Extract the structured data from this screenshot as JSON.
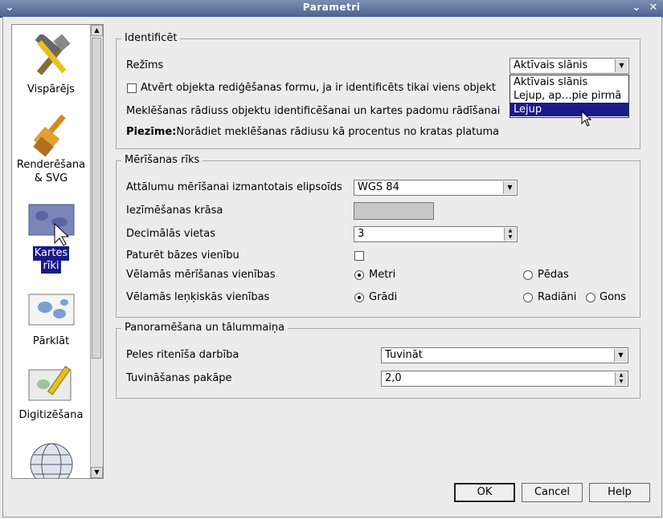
{
  "window": {
    "title": "Parametri"
  },
  "sidebar": {
    "items": [
      {
        "label1": "Vispārējs",
        "label2": "",
        "icon": "tools-icon"
      },
      {
        "label1": "Renderēšana",
        "label2": "& SVG",
        "icon": "brush-icon"
      },
      {
        "label1": "Kartes",
        "label2": "rīki",
        "icon": "map-pointer-icon",
        "selected": true
      },
      {
        "label1": "Pārklāt",
        "label2": "",
        "icon": "overlay-map-icon"
      },
      {
        "label1": "Digitizēšana",
        "label2": "",
        "icon": "digitize-pencil-icon"
      },
      {
        "label1": "",
        "label2": "",
        "icon": "globe-icon"
      }
    ]
  },
  "identify": {
    "group_title": "Identificēt",
    "mode_label": "Režīms",
    "mode_value": "Aktīvais slānis",
    "open_form_label": "Atvērt objekta rediģēšanas formu, ja ir identificēts tikai viens objekt",
    "search_radius_label": "Meklēšanas rādiuss objektu identificēšanai un kartes padomu rādīšanai",
    "note_bold": "Piezīme:",
    "note_text": "Norādiet meklēšanas rādiusu kā procentus no kratas platuma",
    "dropdown_options": [
      "Aktīvais slānis",
      "Lejup, ap…pie pirmā",
      "Lejup"
    ],
    "dropdown_highlighted": "Lejup"
  },
  "measure": {
    "group_title": "Mērīšanas rīks",
    "ellipsoid_label": "Attālumu mērīšanai izmantotais elipsoīds",
    "ellipsoid_value": "WGS 84",
    "color_label": "Iezīmēšanas krāsa",
    "color_value": "#c8c8c8",
    "decimals_label": "Decimālās vietas",
    "decimals_value": "3",
    "keep_base_label": "Paturēt bāzes vienību",
    "units_label": "Vēlamās mērīšanas vienības",
    "units_opt_meters": "Metri",
    "units_opt_feet": "Pēdas",
    "angle_label": "Vēlamās leņķiskās vienības",
    "angle_opt_degrees": "Grādi",
    "angle_opt_radians": "Radiāni",
    "angle_opt_gons": "Gons"
  },
  "pan": {
    "group_title": "Panoramēšana un tālummaiņa",
    "wheel_label": "Peles ritenīša darbība",
    "wheel_value": "Tuvināt",
    "zoom_factor_label": "Tuvināšanas pakāpe",
    "zoom_factor_value": "2,0"
  },
  "buttons": {
    "ok": "OK",
    "cancel": "Cancel",
    "help": "Help"
  }
}
